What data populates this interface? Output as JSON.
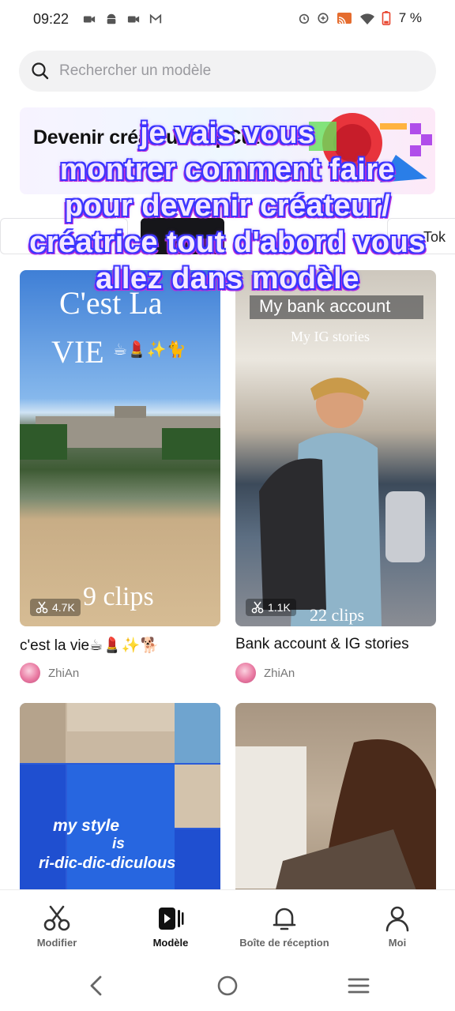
{
  "status_bar": {
    "time": "09:22",
    "battery_percent": "7 %",
    "icons_left": [
      "video-camera-icon",
      "android-icon",
      "video-camera-icon",
      "gmail-icon"
    ],
    "icons_right": [
      "alarm-icon",
      "data-saver-icon",
      "cast-icon",
      "wifi-icon",
      "battery-low-icon"
    ]
  },
  "search": {
    "placeholder": "Rechercher un modèle"
  },
  "banner": {
    "title": "Devenir créateur CapCut"
  },
  "categories": {
    "right_chip_label": "Tok"
  },
  "caption_overlay": {
    "lines": [
      "je vais vous",
      "montrer comment faire",
      "pour  devenir créateur/",
      "créatrice tout d'abord vous",
      "allez dans modèle"
    ]
  },
  "templates": [
    {
      "thumb_title_line1": "C'est La",
      "thumb_title_line2": "VIE",
      "thumb_emoji": "☕💄✨🐈",
      "uses": "4.7K",
      "clips": "9 clips",
      "title": "c'est la vie☕💄✨🐕",
      "author": "ZhiAn"
    },
    {
      "thumb_banner": "My bank account",
      "thumb_subtitle": "My IG stories",
      "uses": "1.1K",
      "clips": "22 clips",
      "title": "Bank account & IG stories",
      "author": "ZhiAn"
    },
    {
      "thumb_line1": "my style",
      "thumb_line2": "is",
      "thumb_line3": "ri-dic-dic-diculous"
    },
    {}
  ],
  "bottom_nav": {
    "items": [
      {
        "label": "Modifier",
        "icon": "scissors-icon"
      },
      {
        "label": "Modèle",
        "icon": "template-icon",
        "active": true
      },
      {
        "label": "Boîte de réception",
        "icon": "bell-icon"
      },
      {
        "label": "Moi",
        "icon": "person-icon"
      }
    ]
  },
  "system_nav": {
    "buttons": [
      "back-icon",
      "home-icon",
      "recents-icon"
    ]
  },
  "colors": {
    "caption_fill": "#f4e8ff",
    "caption_outline": "#3b34ff",
    "caption_shadow": "#c12bd9",
    "active_chip": "#16161a",
    "battery_low": "#e8442e"
  }
}
